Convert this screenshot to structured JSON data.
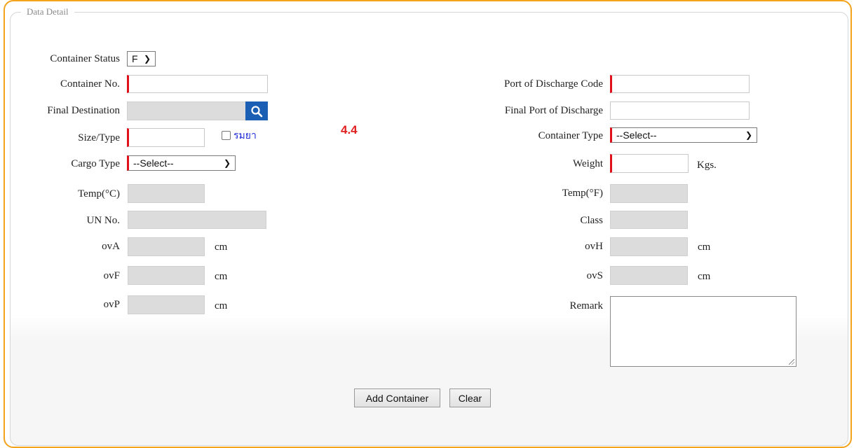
{
  "fieldset": {
    "legend": "Data Detail"
  },
  "left": {
    "container_status": {
      "label": "Container Status",
      "value": "F"
    },
    "container_no": {
      "label": "Container No.",
      "value": ""
    },
    "final_destination": {
      "label": "Final Destination",
      "value": ""
    },
    "size_type": {
      "label": "Size/Type",
      "value": "",
      "checkbox_label": "รมยา",
      "checked": false
    },
    "cargo_type": {
      "label": "Cargo Type",
      "value": "--Select--"
    },
    "temp_c": {
      "label": "Temp(°C)",
      "value": ""
    },
    "un_no": {
      "label": "UN No.",
      "value": ""
    },
    "ova": {
      "label": "ovA",
      "unit": "cm"
    },
    "ovf": {
      "label": "ovF",
      "unit": "cm"
    },
    "ovp": {
      "label": "ovP",
      "unit": "cm"
    }
  },
  "right": {
    "port_of_discharge_code": {
      "label": "Port of Discharge Code",
      "value": ""
    },
    "final_port_of_discharge": {
      "label": "Final Port of Discharge",
      "value": ""
    },
    "container_type": {
      "label": "Container Type",
      "value": "--Select--"
    },
    "weight": {
      "label": "Weight",
      "unit": "Kgs."
    },
    "temp_f": {
      "label": "Temp(°F)",
      "value": ""
    },
    "class": {
      "label": "Class",
      "value": ""
    },
    "ovh": {
      "label": "ovH",
      "unit": "cm"
    },
    "ovs": {
      "label": "ovS",
      "unit": "cm"
    },
    "remark": {
      "label": "Remark",
      "value": ""
    }
  },
  "annotation": "4.4",
  "buttons": {
    "add": "Add Container",
    "clear": "Clear"
  },
  "colors": {
    "frame": "#f3a31c",
    "required": "#e0101a",
    "search_button": "#1a5fb4",
    "checkbox_text": "#1f2bd6",
    "annotation": "#e02020"
  },
  "icons": {
    "search": "search-icon",
    "dropdown": "chevron-down-icon",
    "resize": "resize-grip-icon"
  }
}
